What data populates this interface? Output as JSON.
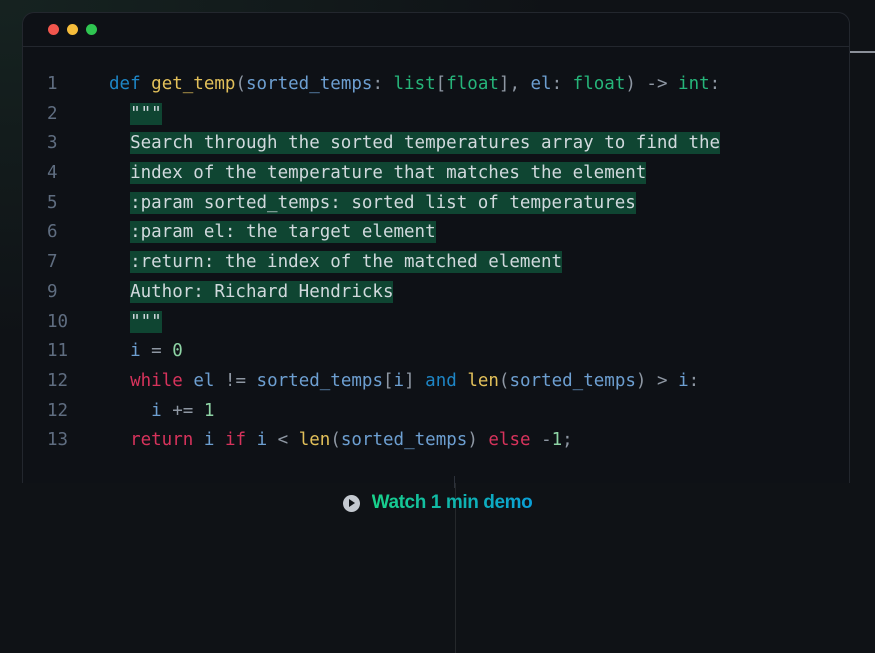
{
  "window": {
    "controls": [
      "close",
      "minimize",
      "maximize"
    ],
    "colors": {
      "close": "#f2564d",
      "minimize": "#f6bd3b",
      "maximize": "#2fc651"
    }
  },
  "code": {
    "lines": [
      {
        "num": "1",
        "tokens": [
          {
            "t": "def",
            "c": "kw-def"
          },
          {
            "t": " "
          },
          {
            "t": "get_temp",
            "c": "fn"
          },
          {
            "t": "(",
            "c": "punc"
          },
          {
            "t": "sorted_temps",
            "c": "param"
          },
          {
            "t": ": ",
            "c": "punc"
          },
          {
            "t": "list",
            "c": "type"
          },
          {
            "t": "[",
            "c": "punc"
          },
          {
            "t": "float",
            "c": "type"
          },
          {
            "t": "], ",
            "c": "punc"
          },
          {
            "t": "el",
            "c": "param"
          },
          {
            "t": ": ",
            "c": "punc"
          },
          {
            "t": "float",
            "c": "type"
          },
          {
            "t": ") -> ",
            "c": "punc"
          },
          {
            "t": "int",
            "c": "type"
          },
          {
            "t": ":",
            "c": "punc"
          }
        ]
      },
      {
        "num": "2",
        "indent": 1,
        "doc": "\"\"\""
      },
      {
        "num": "3",
        "indent": 1,
        "doc": "Search through the sorted temperatures array to find the"
      },
      {
        "num": "4",
        "indent": 1,
        "doc": "index of the temperature that matches the element"
      },
      {
        "num": "5",
        "indent": 1,
        "doc": ":param sorted_temps: sorted list of temperatures"
      },
      {
        "num": "6",
        "indent": 1,
        "doc": ":param el: the target element"
      },
      {
        "num": "7",
        "indent": 1,
        "doc": ":return: the index of the matched element"
      },
      {
        "num": "9",
        "indent": 1,
        "doc": "Author: Richard Hendricks"
      },
      {
        "num": "10",
        "indent": 1,
        "doc": "\"\"\""
      },
      {
        "num": "11",
        "indent": 1,
        "tokens": [
          {
            "t": "i",
            "c": "param"
          },
          {
            "t": " = ",
            "c": "punc"
          },
          {
            "t": "0",
            "c": "num"
          }
        ]
      },
      {
        "num": "12",
        "indent": 1,
        "tokens": [
          {
            "t": "while",
            "c": "ctrl"
          },
          {
            "t": " "
          },
          {
            "t": "el",
            "c": "param"
          },
          {
            "t": " != ",
            "c": "punc"
          },
          {
            "t": "sorted_temps",
            "c": "param"
          },
          {
            "t": "[",
            "c": "punc"
          },
          {
            "t": "i",
            "c": "param"
          },
          {
            "t": "] ",
            "c": "punc"
          },
          {
            "t": "and",
            "c": "and"
          },
          {
            "t": " "
          },
          {
            "t": "len",
            "c": "fn"
          },
          {
            "t": "(",
            "c": "punc"
          },
          {
            "t": "sorted_temps",
            "c": "param"
          },
          {
            "t": ") > ",
            "c": "punc"
          },
          {
            "t": "i",
            "c": "param"
          },
          {
            "t": ":",
            "c": "punc"
          }
        ]
      },
      {
        "num": "12",
        "indent": 2,
        "tokens": [
          {
            "t": "i",
            "c": "param"
          },
          {
            "t": " += ",
            "c": "punc"
          },
          {
            "t": "1",
            "c": "num"
          }
        ]
      },
      {
        "num": "13",
        "indent": 1,
        "tokens": [
          {
            "t": "return",
            "c": "ctrl"
          },
          {
            "t": " "
          },
          {
            "t": "i",
            "c": "param"
          },
          {
            "t": " "
          },
          {
            "t": "if",
            "c": "ctrl"
          },
          {
            "t": " "
          },
          {
            "t": "i",
            "c": "param"
          },
          {
            "t": " < ",
            "c": "punc"
          },
          {
            "t": "len",
            "c": "fn"
          },
          {
            "t": "(",
            "c": "punc"
          },
          {
            "t": "sorted_temps",
            "c": "param"
          },
          {
            "t": ") ",
            "c": "punc"
          },
          {
            "t": "else",
            "c": "ctrl"
          },
          {
            "t": " -",
            "c": "punc"
          },
          {
            "t": "1",
            "c": "num"
          },
          {
            "t": ";",
            "c": "punc"
          }
        ]
      }
    ]
  },
  "footer": {
    "icon": "play-icon",
    "label": "Watch 1 min demo"
  }
}
